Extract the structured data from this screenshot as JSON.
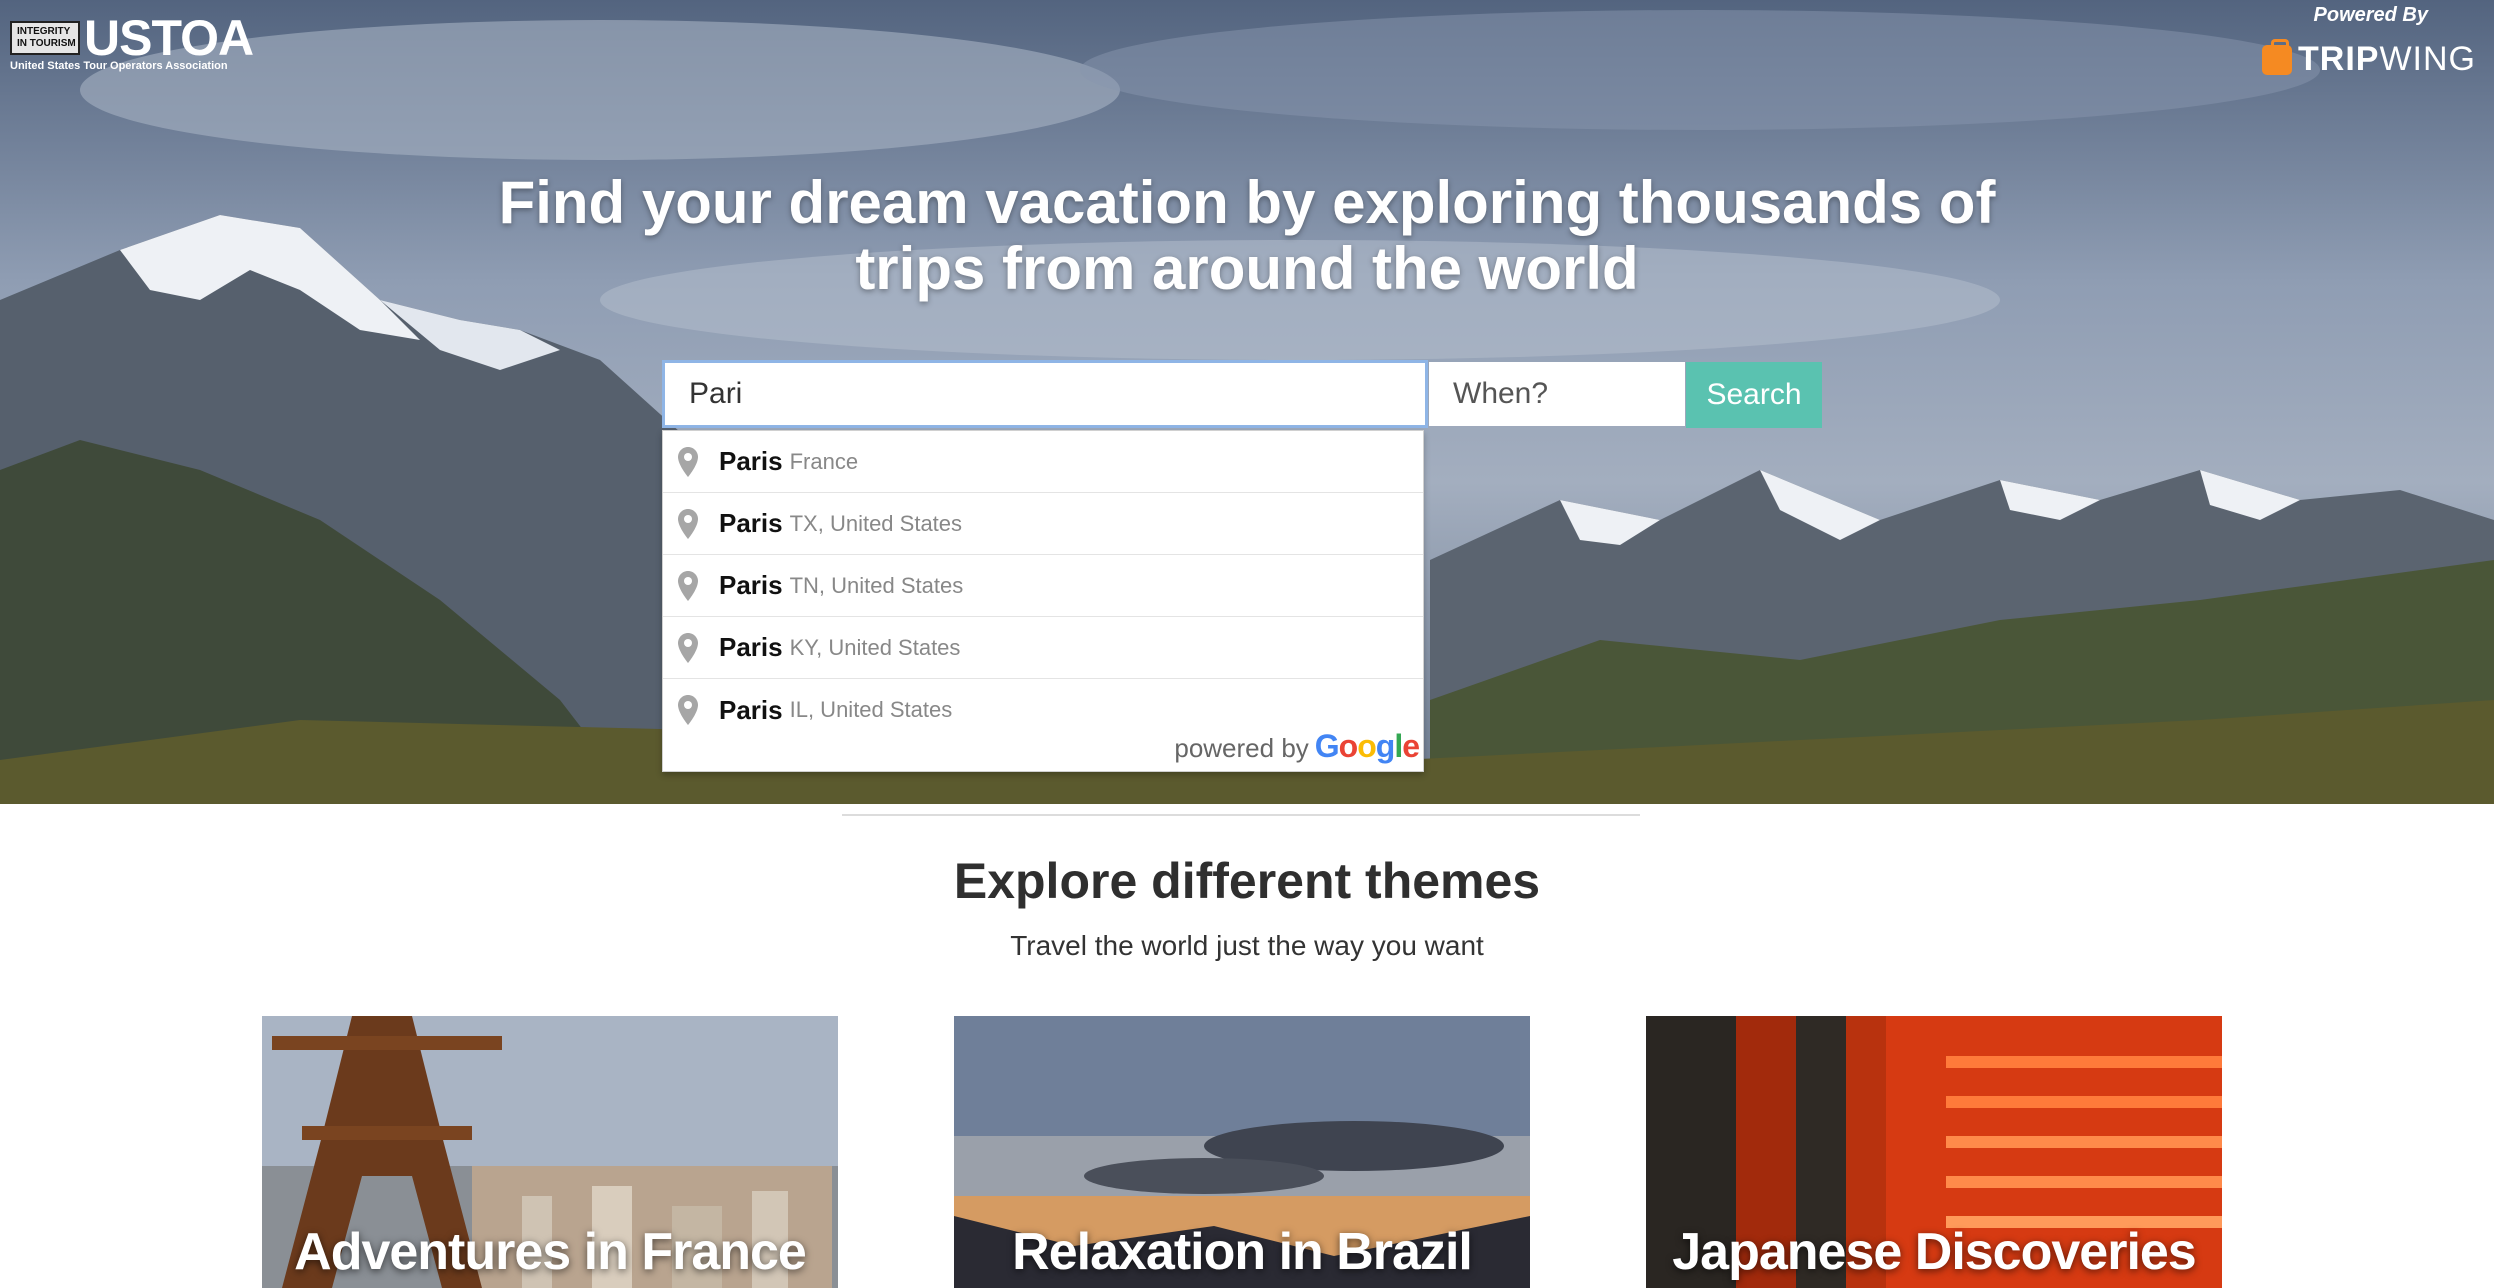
{
  "header": {
    "logo_badge_line1": "INTEGRITY",
    "logo_badge_line2": "IN TOURISM",
    "logo_word": "USTOA",
    "logo_subtitle": "United States Tour Operators Association",
    "powered_by": "Powered By",
    "partner_bold": "TRIP",
    "partner_light": "WING"
  },
  "hero": {
    "headline_line1": "Find your dream vacation by exploring thousands of",
    "headline_line2": "trips from around the world"
  },
  "search": {
    "destination_value": "Pari",
    "when_placeholder": "When?",
    "button_label": "Search"
  },
  "autocomplete": {
    "items": [
      {
        "main": "Paris",
        "secondary": "France"
      },
      {
        "main": "Paris",
        "secondary": "TX, United States"
      },
      {
        "main": "Paris",
        "secondary": "TN, United States"
      },
      {
        "main": "Paris",
        "secondary": "KY, United States"
      },
      {
        "main": "Paris",
        "secondary": "IL, United States"
      }
    ],
    "footer_prefix": "powered by",
    "footer_brand": "Google"
  },
  "themes": {
    "title": "Explore different themes",
    "subtitle": "Travel the world just the way you want",
    "cards": [
      {
        "title": "Adventures in France"
      },
      {
        "title": "Relaxation in Brazil"
      },
      {
        "title": "Japanese Discoveries"
      }
    ]
  },
  "colors": {
    "search_button": "#5ac2b0",
    "input_focus_border": "#8fb5e6",
    "brand_orange": "#f58a22"
  }
}
